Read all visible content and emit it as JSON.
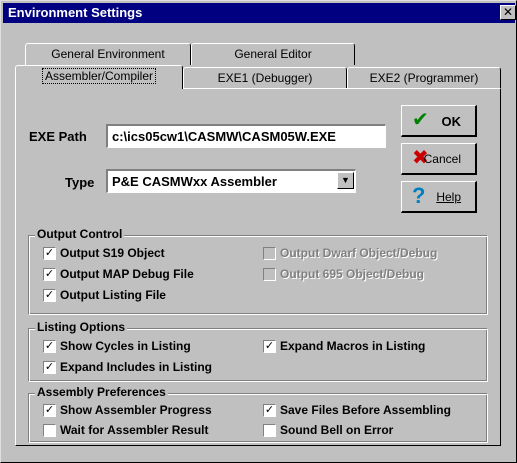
{
  "window": {
    "title": "Environment Settings",
    "close_glyph": "✕"
  },
  "tabs": {
    "row1": [
      "General Environment",
      "General Editor"
    ],
    "row2": [
      "Assembler/Compiler",
      "EXE1 (Debugger)",
      "EXE2 (Programmer)"
    ],
    "active": "Assembler/Compiler"
  },
  "exe_path": {
    "label": "EXE Path",
    "value": "c:\\ics05cw1\\CASMW\\CASM05W.EXE"
  },
  "type": {
    "label": "Type",
    "value": "P&E CASMWxx Assembler"
  },
  "buttons": {
    "ok": {
      "label": "OK",
      "icon": "checkmark-icon",
      "color": "#008000"
    },
    "cancel": {
      "label": "Cancel",
      "icon": "x-mark-icon",
      "color": "#cc0000"
    },
    "help": {
      "label": "Help",
      "icon": "question-mark-icon",
      "color": "#0080c0"
    }
  },
  "output_control": {
    "title": "Output Control",
    "options": [
      {
        "label": "Output S19 Object",
        "checked": true,
        "enabled": true
      },
      {
        "label": "Output MAP Debug File",
        "checked": true,
        "enabled": true
      },
      {
        "label": "Output Listing File",
        "checked": true,
        "enabled": true
      },
      {
        "label": "Output Dwarf Object/Debug",
        "checked": false,
        "enabled": false
      },
      {
        "label": "Output 695 Object/Debug",
        "checked": false,
        "enabled": false
      }
    ]
  },
  "listing_options": {
    "title": "Listing Options",
    "options": [
      {
        "label": "Show Cycles in Listing",
        "checked": true
      },
      {
        "label": "Expand Includes in Listing",
        "checked": true
      },
      {
        "label": "Expand Macros in Listing",
        "checked": true
      }
    ]
  },
  "assembly_preferences": {
    "title": "Assembly Preferences",
    "options": [
      {
        "label": "Show Assembler Progress",
        "checked": true
      },
      {
        "label": "Wait for Assembler Result",
        "checked": false
      },
      {
        "label": "Save Files Before Assembling",
        "checked": true
      },
      {
        "label": "Sound Bell on Error",
        "checked": false
      }
    ]
  }
}
